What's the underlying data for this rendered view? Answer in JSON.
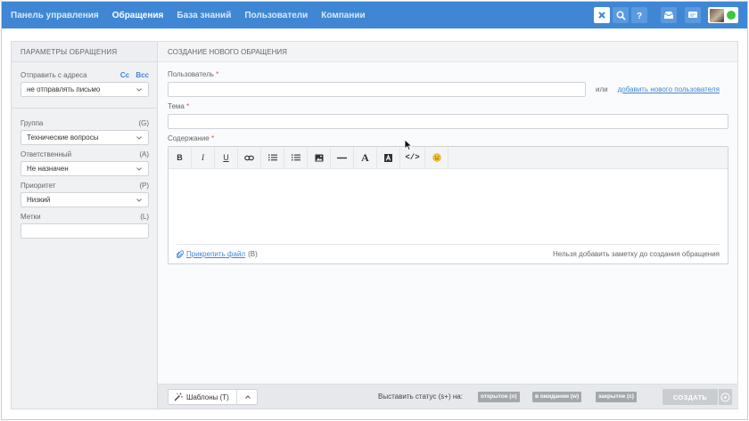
{
  "colors": {
    "topbar": "#3f87d4",
    "link": "#3f87d4",
    "required": "#e14b4b",
    "online": "#3ec73e",
    "badge": "#a3a8ae",
    "create_disabled": "#c9cdd2"
  },
  "nav": {
    "items": [
      {
        "label": "Панель управления",
        "active": false
      },
      {
        "label": "Обращения",
        "active": true
      },
      {
        "label": "База знаний",
        "active": false
      },
      {
        "label": "Пользователи",
        "active": false
      },
      {
        "label": "Компании",
        "active": false
      }
    ]
  },
  "topbar_icons": [
    "close-icon",
    "search-icon",
    "help-icon",
    "inbox-icon",
    "chat-icon",
    "avatar",
    "online-status-dot"
  ],
  "params": {
    "title": "ПАРАМЕТРЫ ОБРАЩЕНИЯ",
    "send_from": {
      "label": "Отправить с адреса",
      "cc": "Cc",
      "bcc": "Bcc",
      "value": "не отправлять письмо"
    },
    "group": {
      "label": "Группа",
      "hotkey": "(G)",
      "value": "Технические вопросы"
    },
    "assignee": {
      "label": "Ответственный",
      "hotkey": "(A)",
      "value": "Не назначен"
    },
    "priority": {
      "label": "Приоритет",
      "hotkey": "(P)",
      "value": "Низкий"
    },
    "tags": {
      "label": "Метки",
      "hotkey": "(L)",
      "value": ""
    }
  },
  "create": {
    "title": "СОЗДАНИЕ НОВОГО ОБРАЩЕНИЯ",
    "user_label": "Пользователь",
    "required_mark": "*",
    "or_text": "или",
    "add_user_link": "добавить нового пользователя",
    "subject_label": "Тема",
    "content_label": "Содержание",
    "toolbar": {
      "bold": "B",
      "italic": "I",
      "underline": "U",
      "font_color": "A",
      "code": "</>"
    },
    "toolbar_icons": [
      "bold-icon",
      "italic-icon",
      "underline-icon",
      "link-icon",
      "ordered-list-icon",
      "bullet-list-icon",
      "image-icon",
      "horizontal-rule-icon",
      "font-color-icon",
      "background-color-icon",
      "code-icon",
      "emoji-icon"
    ],
    "attach_link": "Прикрепить файл",
    "attach_hotkey": "(B)",
    "note_text": "Нельзя добавить заметку до создания обращения"
  },
  "bottom": {
    "templates_label": "Шаблоны (T)",
    "status_label": "Выставить статус (s+) на:",
    "statuses": [
      "открытое (o)",
      "в ожидании (w)",
      "закрытое (c)"
    ],
    "create_label": "СОЗДАТЬ"
  }
}
